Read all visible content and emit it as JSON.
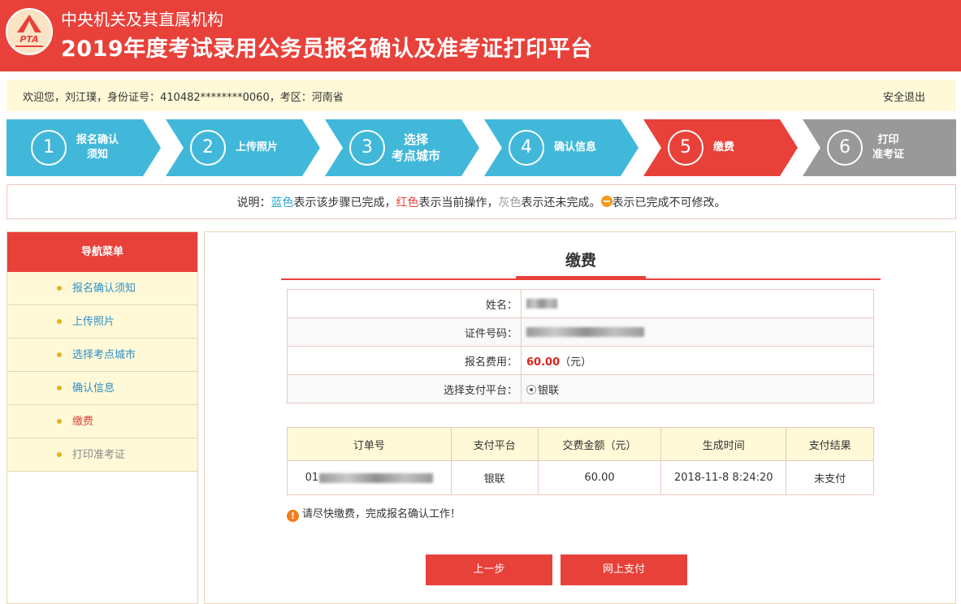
{
  "header": {
    "logo_text": "PTA",
    "org": "中央机关及其直属机构",
    "title": "2019年度考试录用公务员报名确认及准考证打印平台"
  },
  "welcome": {
    "text": "欢迎您，刘江璞，身份证号：410482********0060，考区：河南省",
    "logout": "安全退出"
  },
  "steps": [
    {
      "num": "1",
      "label": "报名确认\n须知",
      "state": "done"
    },
    {
      "num": "2",
      "label": "上传照片",
      "state": "done"
    },
    {
      "num": "3",
      "label": "选择\n考点城市",
      "state": "done"
    },
    {
      "num": "4",
      "label": "确认信息",
      "state": "done"
    },
    {
      "num": "5",
      "label": "缴费",
      "state": "current"
    },
    {
      "num": "6",
      "label": "打印\n准考证",
      "state": "todo"
    }
  ],
  "colors": {
    "done": "#41b8d9",
    "current": "#e8413a",
    "todo": "#999999",
    "accent": "#e8413a"
  },
  "legend": {
    "prefix": "说明：",
    "blue_word": "蓝色",
    "blue_desc": "表示该步骤已完成，",
    "red_word": "红色",
    "red_desc": "表示当前操作，",
    "gray_word": "灰色",
    "gray_desc": "表示还未完成。",
    "icon_desc": "表示已完成不可修改。"
  },
  "sidebar": {
    "title": "导航菜单",
    "items": [
      {
        "label": "报名确认须知",
        "state": "done"
      },
      {
        "label": "上传照片",
        "state": "done"
      },
      {
        "label": "选择考点城市",
        "state": "done"
      },
      {
        "label": "确认信息",
        "state": "done"
      },
      {
        "label": "缴费",
        "state": "current"
      },
      {
        "label": "打印准考证",
        "state": "todo"
      }
    ]
  },
  "payment": {
    "title": "缴费",
    "name_label": "姓名：",
    "id_label": "证件号码：",
    "fee_label": "报名费用：",
    "fee_value": "60.00",
    "fee_unit": "（元）",
    "platform_label": "选择支付平台：",
    "platform_option": "银联"
  },
  "orders": {
    "headers": [
      "订单号",
      "支付平台",
      "交费金额（元）",
      "生成时间",
      "支付结果"
    ],
    "rows": [
      {
        "order_no_prefix": "01",
        "platform": "银联",
        "amount": "60.00",
        "time": "2018-11-8 8:24:20",
        "result": "未支付"
      }
    ]
  },
  "notice": {
    "icon": "!",
    "text": "请尽快缴费，完成报名确认工作！"
  },
  "buttons": {
    "prev": "上一步",
    "pay": "网上支付"
  }
}
